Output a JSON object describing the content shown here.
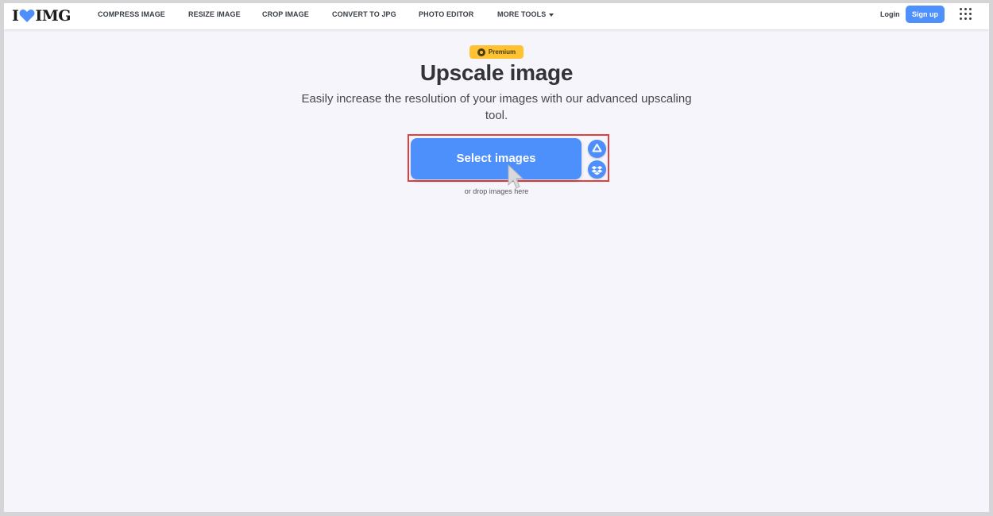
{
  "header": {
    "logo_text_left": "I",
    "logo_text_right": "IMG",
    "nav": [
      {
        "label": "COMPRESS IMAGE"
      },
      {
        "label": "RESIZE IMAGE"
      },
      {
        "label": "CROP IMAGE"
      },
      {
        "label": "CONVERT TO JPG"
      },
      {
        "label": "PHOTO EDITOR"
      },
      {
        "label": "MORE TOOLS"
      }
    ],
    "login_label": "Login",
    "signup_label": "Sign up"
  },
  "hero": {
    "badge": "Premium",
    "title": "Upscale image",
    "subtitle": "Easily increase the resolution of your images with our advanced upscaling tool.",
    "select_button": "Select images",
    "drop_hint": "or drop images here",
    "cloud_buttons": [
      {
        "icon": "google-drive-icon"
      },
      {
        "icon": "dropbox-icon"
      }
    ]
  },
  "colors": {
    "accent": "#4d8ffb",
    "brand_heart": "#4d8ffb",
    "premium": "#ffc233",
    "highlight": "#e0413d"
  }
}
